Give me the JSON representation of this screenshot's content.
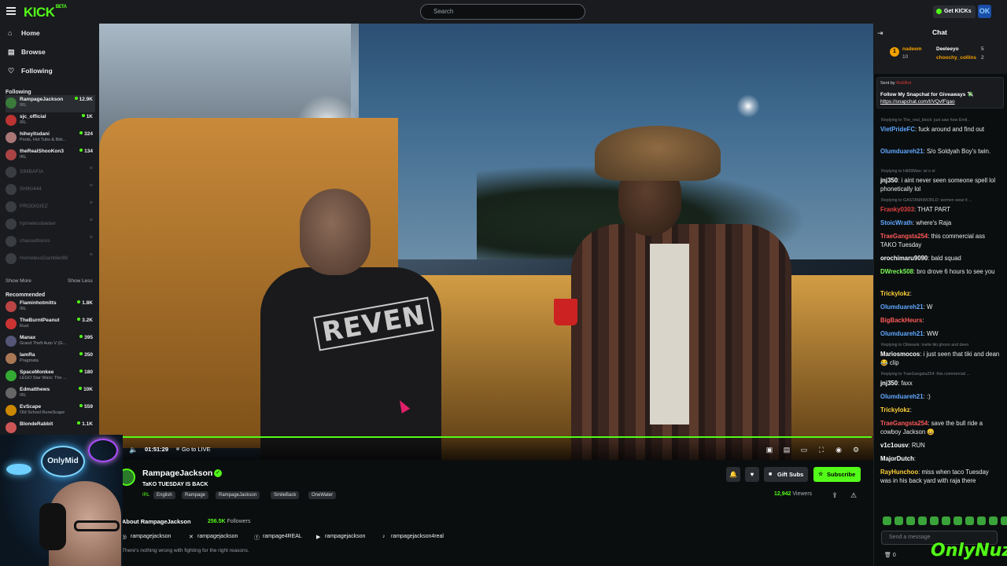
{
  "header": {
    "logo": "KICK",
    "logo_beta": "BETA",
    "search_placeholder": "Search",
    "get_kicks_label": "Get KICKs",
    "avatar_text": "OK"
  },
  "sidebar": {
    "nav": [
      {
        "label": "Home",
        "icon": "home-icon"
      },
      {
        "label": "Browse",
        "icon": "browse-icon"
      },
      {
        "label": "Following",
        "icon": "heart-icon"
      }
    ],
    "following_title": "Following",
    "following": [
      {
        "name": "RampageJackson",
        "category": "IRL",
        "viewers": "12.9K",
        "color": "#3a7a3a"
      },
      {
        "name": "sjc_official",
        "category": "IRL",
        "viewers": "1K",
        "color": "#b33"
      },
      {
        "name": "hiheyitsdani",
        "category": "Pools, Hot Tubs & Biki...",
        "viewers": "324",
        "color": "#a77"
      },
      {
        "name": "theRealShooKon3",
        "category": "IRL",
        "viewers": "134",
        "color": "#a44"
      }
    ],
    "offline": [
      "SIMBAFIA",
      "SHIKI444",
      "PRODIGIEZ",
      "hpmelessbieber",
      "chaosettoons",
      "HomelessGambler89"
    ],
    "show_more": "Show More",
    "show_less": "Show Less",
    "recommended_title": "Recommended",
    "recommended": [
      {
        "name": "Flaminhotmitts",
        "category": "IRL",
        "viewers": "1.8K",
        "color": "#b44"
      },
      {
        "name": "TheBurntPeanut",
        "category": "Rust",
        "viewers": "3.2K",
        "color": "#c33"
      },
      {
        "name": "Manax",
        "category": "Grand Theft Auto V (G...",
        "viewers": "395",
        "color": "#557"
      },
      {
        "name": "IamRa",
        "category": "Pragmata",
        "viewers": "350",
        "color": "#a75"
      },
      {
        "name": "SpaceMonkee",
        "category": "LEGO Star Wars: The ...",
        "viewers": "180",
        "color": "#3a3"
      },
      {
        "name": "Edmatthews",
        "category": "IRL",
        "viewers": "10K",
        "color": "#666"
      },
      {
        "name": "EvScape",
        "category": "Old School RuneScape",
        "viewers": "559",
        "color": "#c80"
      },
      {
        "name": "BlondeRabbit",
        "category": "",
        "viewers": "1.1K",
        "color": "#c55"
      }
    ]
  },
  "player": {
    "time": "01:51:29",
    "go_live": "Go to LIVE",
    "progress": 1.0
  },
  "stream": {
    "streamer": "RampageJackson",
    "title": "TaKO TUESDAY IS BACK",
    "category": "IRL",
    "tags": [
      "English",
      "Rampage",
      "RampageJackson",
      "SmileBack",
      "OneWater"
    ],
    "gift_label": "Gift Subs",
    "subscribe_label": "Subscribe",
    "viewers": "12,942",
    "viewers_label": "Viewers",
    "about": "About RampageJackson",
    "followers": "256.5K",
    "followers_label": "Followers",
    "socials": [
      {
        "icon": "instagram-icon",
        "handle": "rampagejackson"
      },
      {
        "icon": "x-icon",
        "handle": "rampagejackson"
      },
      {
        "icon": "facebook-icon",
        "handle": "rampage4REAL"
      },
      {
        "icon": "youtube-icon",
        "handle": "rampagejackson"
      },
      {
        "icon": "tiktok-icon",
        "handle": "rampagejackson4real"
      }
    ],
    "bio": "There's nothing wrong with fighting for the right reasons."
  },
  "video": {
    "shirt_text": "REVEN"
  },
  "webcam": {
    "overlay_text": "OnlyMid"
  },
  "chat": {
    "title": "Chat",
    "leaderboard": [
      {
        "name": "nadeem",
        "count": "10",
        "color": "#f2a100"
      },
      {
        "name": "Deeleeyo",
        "count": "5",
        "color": "#ffffff"
      },
      {
        "name": "choochy_collins",
        "count": "2",
        "color": "#f2a100"
      }
    ],
    "pinned_sent_by": "Sent by",
    "pinned_user": "RoEBot",
    "pinned_message": "Follow My Snapchat for Giveaways 💸",
    "pinned_link": "https://snapchat.com/t/VQvfFqao",
    "messages": [
      {
        "reply": "Replying to The_real_block: just saw how Emil...",
        "user": "VietPrideFC",
        "color": "#5fa8ff",
        "text": "fuck around and find out"
      },
      {
        "reply": "",
        "user": "Olumduareh21",
        "color": "#5fa8ff",
        "text": "S/o Soldyah Boy's twin."
      },
      {
        "reply": "Replying to Hit59Man: wi o el",
        "user": "jnj350",
        "color": "#ffffff",
        "text": "i aint never seen someone spell lol phonetically lol"
      },
      {
        "reply": "Replying to GASTANKWORLD: women wear it ...",
        "user": "Franky0303",
        "color": "#e04040",
        "text": "THAT PART"
      },
      {
        "reply": "",
        "user": "StoicWrath",
        "color": "#5fa8ff",
        "text": "where's Raja"
      },
      {
        "reply": "",
        "user": "TraeGangsta254",
        "color": "#ff5a5a",
        "text": "this commercial ass TAKO Tuesday"
      },
      {
        "reply": "",
        "user": "orochimaru9090",
        "color": "#ffffff",
        "text": "bald squad"
      },
      {
        "reply": "",
        "user": "DWreck508",
        "color": "#7cff5a",
        "text": "bro drove 6 hours to see you"
      },
      {
        "reply": "",
        "user": "Trickylokz",
        "color": "#ffd23a",
        "text": ""
      },
      {
        "reply": "",
        "user": "Olumduareh21",
        "color": "#5fa8ff",
        "text": "W"
      },
      {
        "reply": "",
        "user": "BigBackHeurs",
        "color": "#ff5a5a",
        "text": ""
      },
      {
        "reply": "",
        "user": "Olumduareh21",
        "color": "#5fa8ff",
        "text": "WW"
      },
      {
        "reply": "Replying to Obiwank: invite tiki ghosn and deen",
        "user": "Mariosmocos",
        "color": "#ffffff",
        "text": "i just seen that tiki and dean 😂 clip"
      },
      {
        "reply": "Replying to TraeGangsta254: this commercial ...",
        "user": "jnj350",
        "color": "#ffffff",
        "text": "faxx"
      },
      {
        "reply": "",
        "user": "Olumduareh21",
        "color": "#5fa8ff",
        "text": ":)"
      },
      {
        "reply": "",
        "user": "Trickylokz",
        "color": "#ffd23a",
        "text": ""
      },
      {
        "reply": "",
        "user": "TraeGangsta254",
        "color": "#ff5a5a",
        "text": "save the bull ride a cowboy Jackson 😀"
      },
      {
        "reply": "",
        "user": "v1c1ousv",
        "color": "#ffffff",
        "text": "RUN"
      },
      {
        "reply": "",
        "user": "MajorDutch",
        "color": "#ffffff",
        "text": ""
      },
      {
        "reply": "",
        "user": "RayHunchoo",
        "color": "#ffd23a",
        "text": "miss when taco Tuesday was in his back yard with raja there"
      }
    ],
    "input_placeholder": "Send a message",
    "footer_count": "0",
    "watermark": "OnlyNuz"
  },
  "colors": {
    "accent": "#53fc18",
    "bg": "#0b0e0f",
    "panel": "#191b1f"
  }
}
